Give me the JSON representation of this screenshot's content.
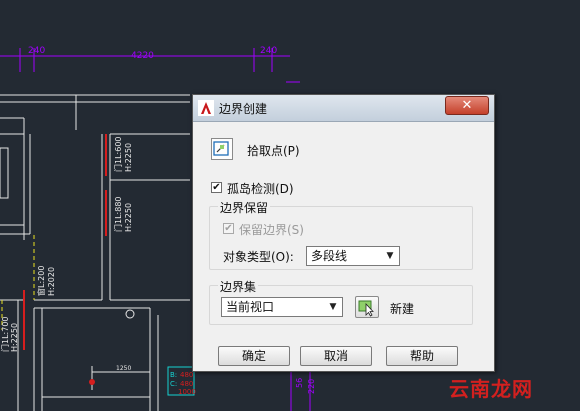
{
  "drawing": {
    "dim_top_left": "240",
    "dim_top_center": "4220",
    "dim_top_right": "240",
    "door_a_w": "门1L:600",
    "door_a_h": "H:2250",
    "door_b_w": "门1L:880",
    "door_b_h": "H:2250",
    "window_w": "窗L:200",
    "window_h": "H:2020",
    "door_c_w": "门1L:700",
    "door_c_h": "H:2250",
    "small_dim": "1250",
    "dim_v1": "56",
    "dim_v2": "220",
    "tag_1": "B:",
    "tag_2": "C:",
    "tag_val_1": "480",
    "tag_val_2": "480",
    "tag_val_3": "1000"
  },
  "dialog": {
    "title": "边界创建",
    "close_label": "✕",
    "pick_points_label": "拾取点(P)",
    "island_detection_label": "孤岛检测(D)",
    "island_detection_checked": true,
    "retain_group_title": "边界保留",
    "retain_boundary_label": "保留边界(S)",
    "retain_boundary_checked": true,
    "object_type_label": "对象类型(O):",
    "object_type_value": "多段线",
    "boundary_set_title": "边界集",
    "boundary_set_value": "当前视口",
    "new_label": "新建",
    "ok_label": "确定",
    "cancel_label": "取消",
    "help_label": "帮助"
  },
  "watermark": "云南龙网",
  "colors": {
    "canvas": "#232a33",
    "cad_line": "#e6e6e6",
    "dimension": "#a000ff",
    "wall_red": "#d61e1e",
    "window_yellow": "#e8e020",
    "tag_cyan": "#16d1d1"
  }
}
